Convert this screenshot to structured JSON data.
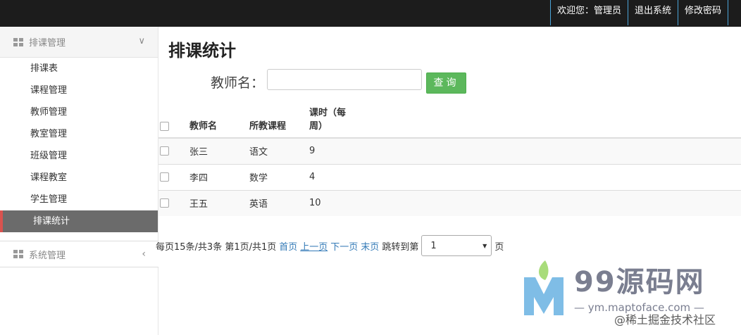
{
  "topbar": {
    "welcome": "欢迎您：管理员",
    "logout": "退出系统",
    "change_password": "修改密码"
  },
  "sidebar": {
    "group1": {
      "label": "排课管理",
      "icon": "grid-icon",
      "chevron": "chevron-down-icon",
      "items": [
        {
          "label": "排课表"
        },
        {
          "label": "课程管理"
        },
        {
          "label": "教师管理"
        },
        {
          "label": "教室管理"
        },
        {
          "label": "班级管理"
        },
        {
          "label": "课程教室"
        },
        {
          "label": "学生管理"
        },
        {
          "label": "排课统计",
          "active": true
        }
      ]
    },
    "group2": {
      "label": "系统管理",
      "icon": "grid-icon",
      "chevron": "chevron-left-icon"
    }
  },
  "main": {
    "title": "排课统计",
    "search": {
      "label": "教师名：",
      "value": "",
      "button": "查询"
    },
    "table": {
      "headers": [
        "教师名",
        "所教课程",
        "课时（每周）"
      ],
      "header_hours_line1": "课时（每",
      "header_hours_line2": "周）",
      "rows": [
        {
          "name": "张三",
          "course": "语文",
          "hours": "9"
        },
        {
          "name": "李四",
          "course": "数学",
          "hours": "4"
        },
        {
          "name": "王五",
          "course": "英语",
          "hours": "10"
        }
      ]
    },
    "pager": {
      "summary": "每页15条/共3条 第1页/共1页",
      "first": "首页",
      "prev": "上一页",
      "next": "下一页",
      "last": "末页",
      "jump_label": "跳转到第",
      "selected_page": "1",
      "suffix": "页"
    }
  },
  "watermark": {
    "brand": "99源码网",
    "url": "— ym.maptoface.com —",
    "juejin": "@稀土掘金技术社区"
  },
  "colors": {
    "topbar_bg": "#1c1c1c",
    "topbar_divider": "#4aa3d8",
    "active_menu_bg": "#6b6b6b",
    "active_menu_marker": "#d9534f",
    "search_button": "#5cb85c",
    "link": "#337ab7"
  }
}
